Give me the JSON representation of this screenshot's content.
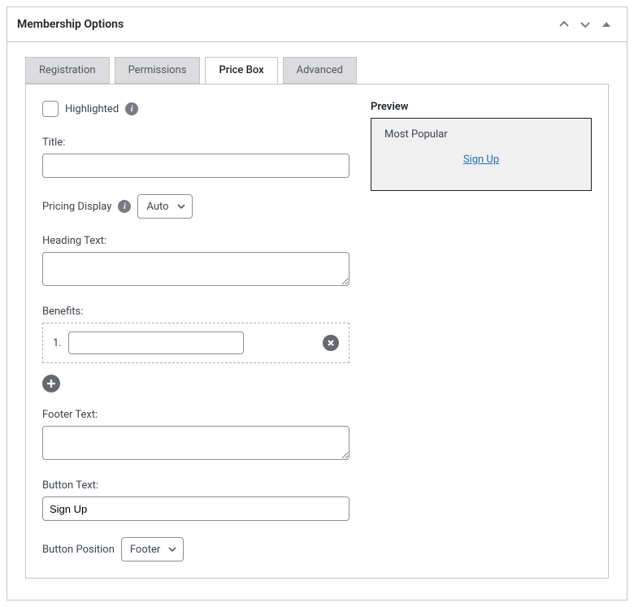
{
  "panel": {
    "title": "Membership Options"
  },
  "tabs": {
    "registration": "Registration",
    "permissions": "Permissions",
    "price_box": "Price Box",
    "advanced": "Advanced"
  },
  "form": {
    "highlighted_label": "Highlighted",
    "title_label": "Title:",
    "title_value": "",
    "pricing_display_label": "Pricing Display",
    "pricing_display_value": "Auto",
    "heading_text_label": "Heading Text:",
    "heading_text_value": "",
    "benefits_label": "Benefits:",
    "benefit_1_num": "1.",
    "benefit_1_value": "",
    "footer_text_label": "Footer Text:",
    "footer_text_value": "",
    "button_text_label": "Button Text:",
    "button_text_value": "Sign Up",
    "button_position_label": "Button Position",
    "button_position_value": "Footer"
  },
  "preview": {
    "title": "Preview",
    "badge": "Most Popular",
    "link": "Sign Up"
  }
}
